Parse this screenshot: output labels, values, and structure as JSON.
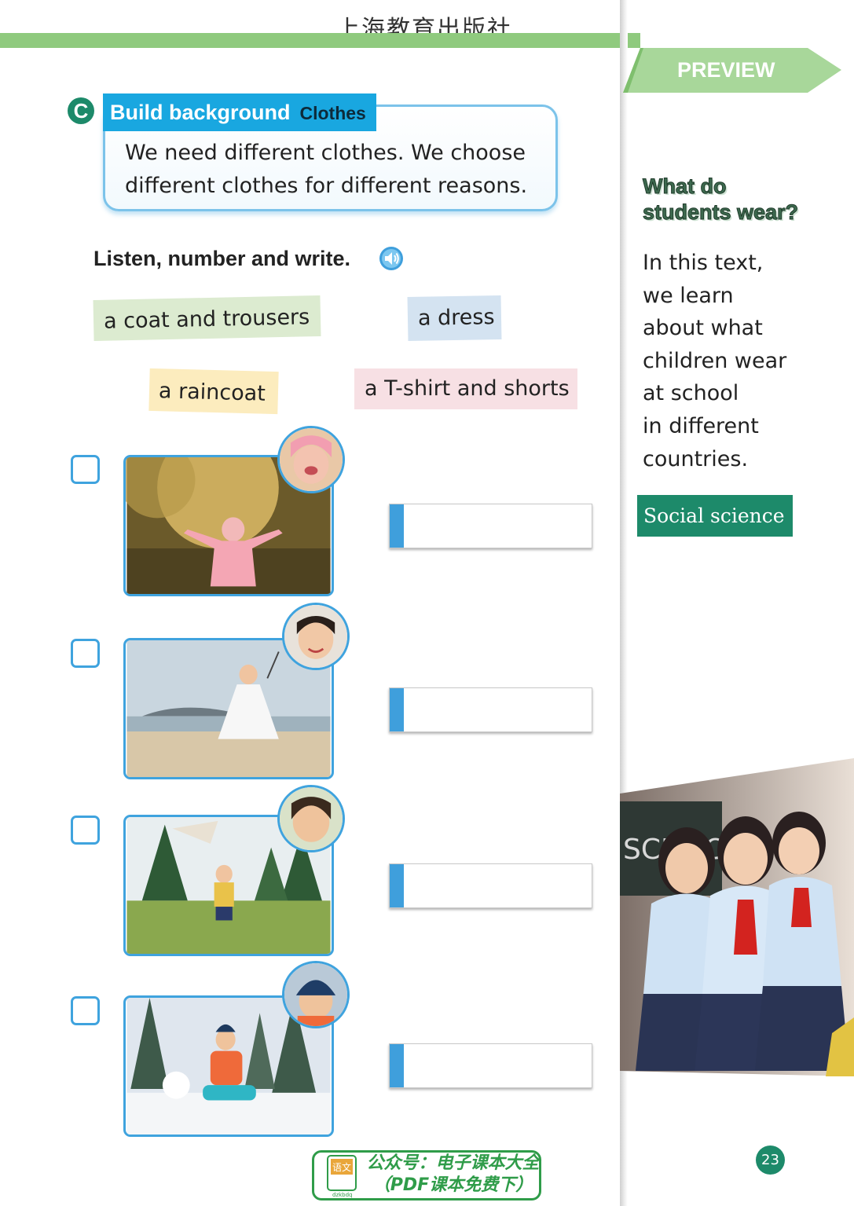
{
  "header": {
    "publisher": "上海教育出版社"
  },
  "preview": {
    "label": "PREVIEW"
  },
  "sidebar": {
    "title_lines": [
      "What do",
      "students wear?"
    ],
    "body_lines": [
      "In this text,",
      "we learn",
      "about what",
      "children wear",
      "at school",
      "in different",
      "countries."
    ],
    "subject": "Social science",
    "photo_icon": "school-girls-photo",
    "photo_caption_text": "SCHOOL"
  },
  "section": {
    "letter": "C",
    "label": "Build background",
    "sublabel": "Clothes",
    "text_lines": [
      "We need different clothes. We choose",
      "different clothes for different reasons."
    ]
  },
  "activity": {
    "instruction": "Listen, number and write.",
    "audio_icon": "speaker-icon",
    "words": [
      "a coat and trousers",
      "a dress",
      "a raincoat",
      "a T-shirt and shorts"
    ],
    "items": [
      {
        "scene": "girl-in-rain-photo",
        "number": "",
        "answer": ""
      },
      {
        "scene": "girl-on-beach-photo",
        "number": "",
        "answer": ""
      },
      {
        "scene": "boy-with-kite-photo",
        "number": "",
        "answer": ""
      },
      {
        "scene": "boy-in-snow-photo",
        "number": "",
        "answer": ""
      }
    ]
  },
  "page_number": "23",
  "watermark": {
    "line1": "公众号：电子课本大全",
    "line2": "（PDF课本免费下）",
    "icon_text": "语文",
    "icon_caption": "dzkbdq"
  },
  "colors": {
    "green_bar": "#8fca7e",
    "teal": "#1d8a6a",
    "blue": "#19a7e0",
    "box_blue": "#3fa3de"
  }
}
